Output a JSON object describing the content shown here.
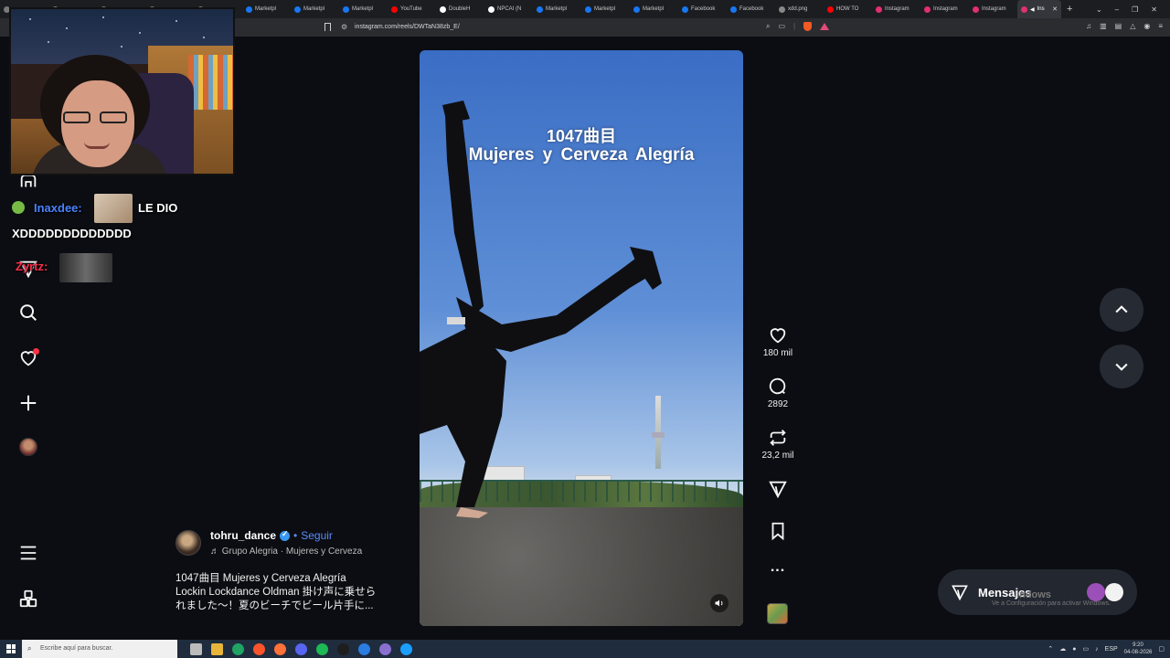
{
  "browser": {
    "tabs": [
      {
        "label": "",
        "favicon_color": "#7a7a7a"
      },
      {
        "label": "",
        "favicon_color": "#7a7a7a"
      },
      {
        "label": "",
        "favicon_color": "#7a7a7a"
      },
      {
        "label": "",
        "favicon_color": "#7a7a7a"
      },
      {
        "label": "",
        "favicon_color": "#7a7a7a"
      },
      {
        "label": "Marketpl",
        "favicon_color": "#1877f2"
      },
      {
        "label": "Marketpl",
        "favicon_color": "#1877f2"
      },
      {
        "label": "Marketpl",
        "favicon_color": "#1877f2"
      },
      {
        "label": "YouTube",
        "favicon_color": "#ff0000"
      },
      {
        "label": "DoubleH",
        "favicon_color": "#ffffff"
      },
      {
        "label": "NPCAI (N",
        "favicon_color": "#ffffff"
      },
      {
        "label": "Marketpl",
        "favicon_color": "#1877f2"
      },
      {
        "label": "Marketpl",
        "favicon_color": "#1877f2"
      },
      {
        "label": "Marketpl",
        "favicon_color": "#1877f2"
      },
      {
        "label": "Facebook",
        "favicon_color": "#1877f2"
      },
      {
        "label": "Facebook",
        "favicon_color": "#1877f2"
      },
      {
        "label": "xdd.png",
        "favicon_color": "#888888"
      },
      {
        "label": "HOW TO",
        "favicon_color": "#ff0000"
      },
      {
        "label": "Instagram",
        "favicon_color": "#e1306c"
      },
      {
        "label": "Instagram",
        "favicon_color": "#e1306c"
      },
      {
        "label": "Instagram",
        "favicon_color": "#e1306c"
      }
    ],
    "active_tab": {
      "label": "Ins",
      "close": "✕"
    },
    "new_tab": "+",
    "url": "instagram.com/reels/DWTaN38zb_E/",
    "window_controls": {
      "dropdown": "⌄",
      "minimize": "–",
      "restore": "❐",
      "close": "✕"
    }
  },
  "chat": {
    "line1_user": "Inaxdee:",
    "line1_text": "LE DIO",
    "line2_text": "XDDDDDDDDDDDDD",
    "line3_user": "Zyrtz:"
  },
  "reel": {
    "overlay_line1": "1047曲目",
    "overlay_line2": "Mujeres y Cerveza   Alegría"
  },
  "actions": {
    "likes": "180 mil",
    "comments": "2892",
    "reposts": "23,2 mil",
    "more": "..."
  },
  "caption": {
    "username": "tohru_dance",
    "separator": "•",
    "follow": "Seguir",
    "audio": "Grupo Alegria · Mujeres y Cerveza",
    "text_line1": "1047曲目 Mujeres y Cerveza Alegría",
    "text_line2": "Lockin Lockdance Oldman 掛け声に乗せら",
    "text_line3": "れました〜！夏のビーチでビール片手に..."
  },
  "messages": {
    "label": "Mensajes",
    "watermark_title": "indows",
    "watermark_sub": "Ve a Configuración para activar Windows."
  },
  "taskbar": {
    "search_placeholder": "Escribe aquí para buscar.",
    "language": "ESP",
    "time": "9:20",
    "date": "04-08-2026",
    "app_colors": [
      "#bbbbbb",
      "#e6b53a",
      "#1fa463",
      "#fb542b",
      "#ff7139",
      "#5865f2",
      "#1db954",
      "#1e1e1e",
      "#2a7de1",
      "#8a6fd1",
      "#1a9fff"
    ]
  },
  "colors": {
    "accent_blue": "#5b8cf8",
    "notification_red": "#ff3040",
    "background": "#0b0d12"
  }
}
